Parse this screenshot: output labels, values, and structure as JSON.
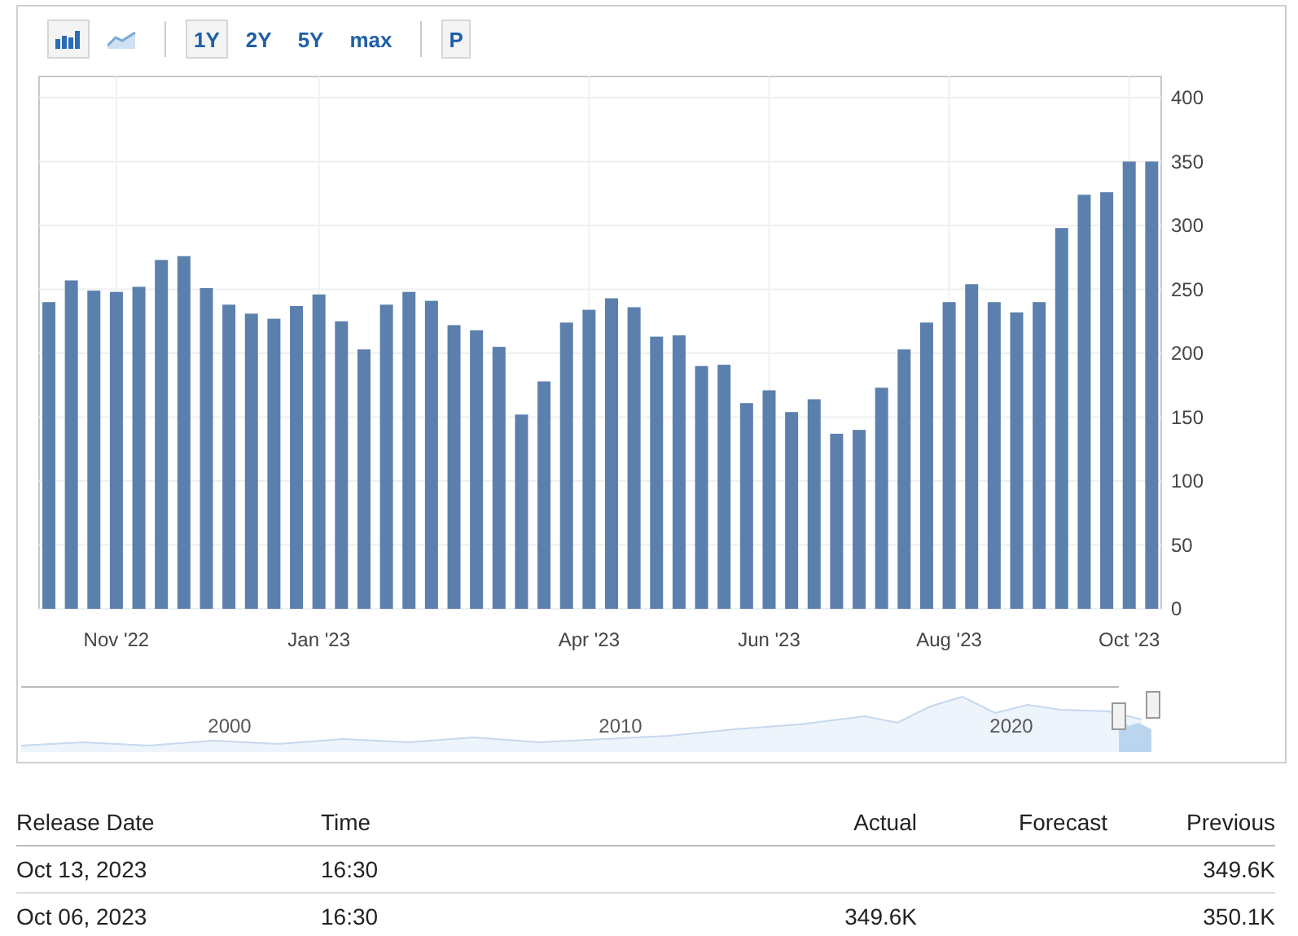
{
  "toolbar": {
    "chart_types": [
      {
        "kind": "bar",
        "selected": true
      },
      {
        "kind": "line",
        "selected": false
      }
    ],
    "ranges": [
      {
        "label": "1Y",
        "selected": true
      },
      {
        "label": "2Y",
        "selected": false
      },
      {
        "label": "5Y",
        "selected": false
      },
      {
        "label": "max",
        "selected": false
      }
    ],
    "print": {
      "label": "P",
      "selected": true
    }
  },
  "chart": {
    "chart_data": {
      "type": "bar",
      "grid": true,
      "ylim": [
        0,
        400
      ],
      "categories": [
        null,
        null,
        null,
        "Nov '22",
        null,
        null,
        null,
        null,
        null,
        null,
        null,
        null,
        "Jan '23",
        null,
        null,
        null,
        null,
        null,
        null,
        null,
        null,
        null,
        null,
        null,
        "Apr '23",
        null,
        null,
        null,
        null,
        null,
        null,
        null,
        "Jun '23",
        null,
        null,
        null,
        null,
        null,
        null,
        null,
        "Aug '23",
        null,
        null,
        null,
        null,
        null,
        null,
        null,
        "Oct '23",
        null
      ],
      "yticks": [
        0,
        50,
        100,
        150,
        200,
        250,
        300,
        350,
        400
      ],
      "series": [
        {
          "color": "#5b80ad",
          "values": [
            240,
            257,
            249,
            248,
            252,
            273,
            276,
            251,
            238,
            231,
            227,
            237,
            246,
            225,
            203,
            238,
            248,
            241,
            222,
            218,
            205,
            152,
            178,
            224,
            234,
            243,
            236,
            213,
            214,
            190,
            191,
            161,
            171,
            154,
            164,
            137,
            140,
            173,
            203,
            224,
            240,
            254,
            240,
            232,
            240,
            298,
            324,
            326,
            350,
            350
          ]
        }
      ]
    }
  },
  "navigator": {
    "labels": [
      "2000",
      "2010",
      "2020"
    ]
  },
  "table": {
    "columns": [
      "Release Date",
      "Time",
      "Actual",
      "Forecast",
      "Previous"
    ],
    "rows": [
      [
        "Oct 13, 2023",
        "16:30",
        "",
        "",
        "349.6K"
      ],
      [
        "Oct 06, 2023",
        "16:30",
        "349.6K",
        "",
        "350.1K"
      ]
    ]
  }
}
